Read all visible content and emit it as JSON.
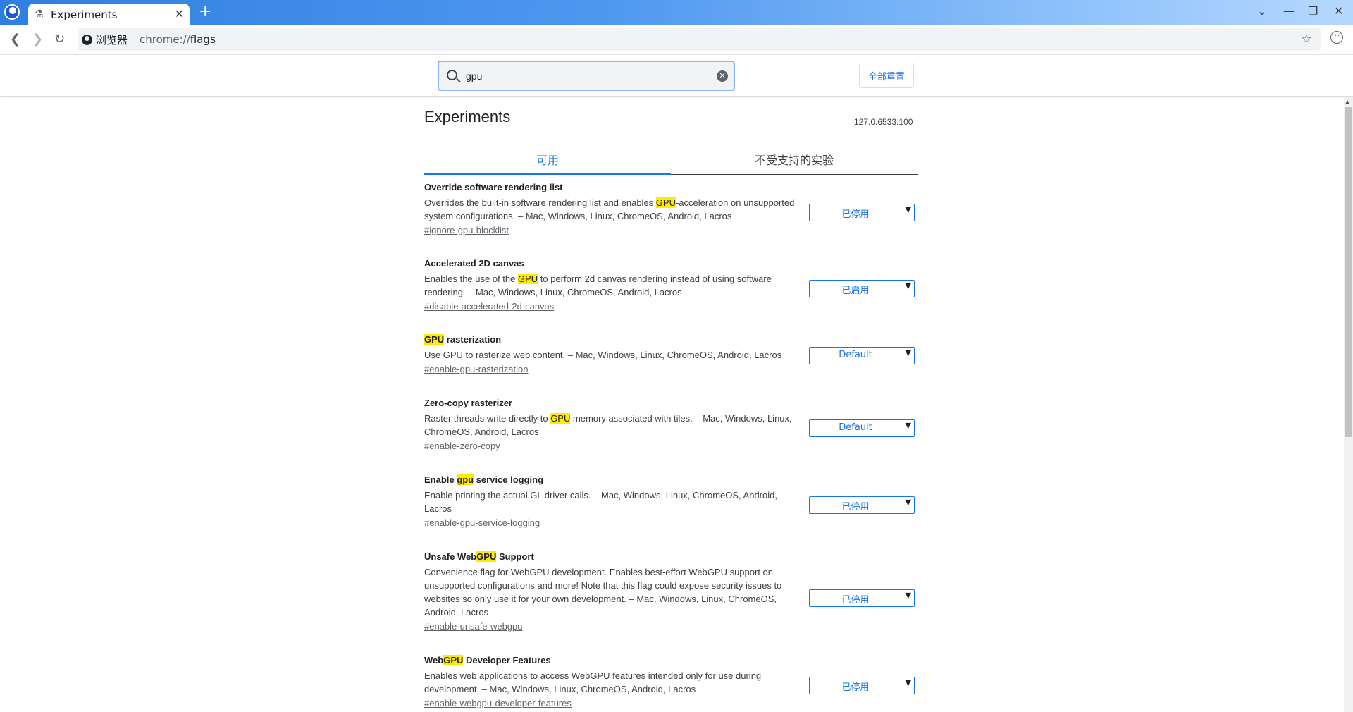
{
  "tab": {
    "title": "Experiments"
  },
  "toolbar": {
    "site_name": "浏览器",
    "url_scheme": "chrome://",
    "url_path": "flags"
  },
  "flags_header": {
    "search_value": "gpu",
    "reset_label": "全部重置"
  },
  "page": {
    "title": "Experiments",
    "version": "127.0.6533.100",
    "tabs": [
      {
        "label": "可用"
      },
      {
        "label": "不受支持的实验"
      }
    ]
  },
  "flags": [
    {
      "name_parts": [
        "Override software rendering list"
      ],
      "desc_parts": [
        "Overrides the built-in software rendering list and enables ",
        "GPU",
        "-acceleration on unsupported system configurations. – Mac, Windows, Linux, ChromeOS, Android, Lacros"
      ],
      "link": "#ignore-gpu-blocklist",
      "value": "已停用"
    },
    {
      "name_parts": [
        "Accelerated 2D canvas"
      ],
      "desc_parts": [
        "Enables the use of the ",
        "GPU",
        " to perform 2d canvas rendering instead of using software rendering. – Mac, Windows, Linux, ChromeOS, Android, Lacros"
      ],
      "link": "#disable-accelerated-2d-canvas",
      "value": "已启用"
    },
    {
      "name_parts": [
        "",
        "GPU",
        " rasterization"
      ],
      "desc_parts": [
        "Use GPU to rasterize web content. – Mac, Windows, Linux, ChromeOS, Android, Lacros"
      ],
      "link": "#enable-gpu-rasterization",
      "value": "Default"
    },
    {
      "name_parts": [
        "Zero-copy rasterizer"
      ],
      "desc_parts": [
        "Raster threads write directly to ",
        "GPU",
        " memory associated with tiles. – Mac, Windows, Linux, ChromeOS, Android, Lacros"
      ],
      "link": "#enable-zero-copy",
      "value": "Default"
    },
    {
      "name_parts": [
        "Enable ",
        "gpu",
        " service logging"
      ],
      "desc_parts": [
        "Enable printing the actual GL driver calls. – Mac, Windows, Linux, ChromeOS, Android, Lacros"
      ],
      "link": "#enable-gpu-service-logging",
      "value": "已停用"
    },
    {
      "name_parts": [
        "Unsafe Web",
        "GPU",
        " Support"
      ],
      "desc_parts": [
        "Convenience flag for WebGPU development. Enables best-effort WebGPU support on unsupported configurations and more! Note that this flag could expose security issues to websites so only use it for your own development. – Mac, Windows, Linux, ChromeOS, Android, Lacros"
      ],
      "link": "#enable-unsafe-webgpu",
      "value": "已停用"
    },
    {
      "name_parts": [
        "Web",
        "GPU",
        " Developer Features"
      ],
      "desc_parts": [
        "Enables web applications to access WebGPU features intended only for use during development. – Mac, Windows, Linux, ChromeOS, Android, Lacros"
      ],
      "link": "#enable-webgpu-developer-features",
      "value": "已停用"
    }
  ]
}
